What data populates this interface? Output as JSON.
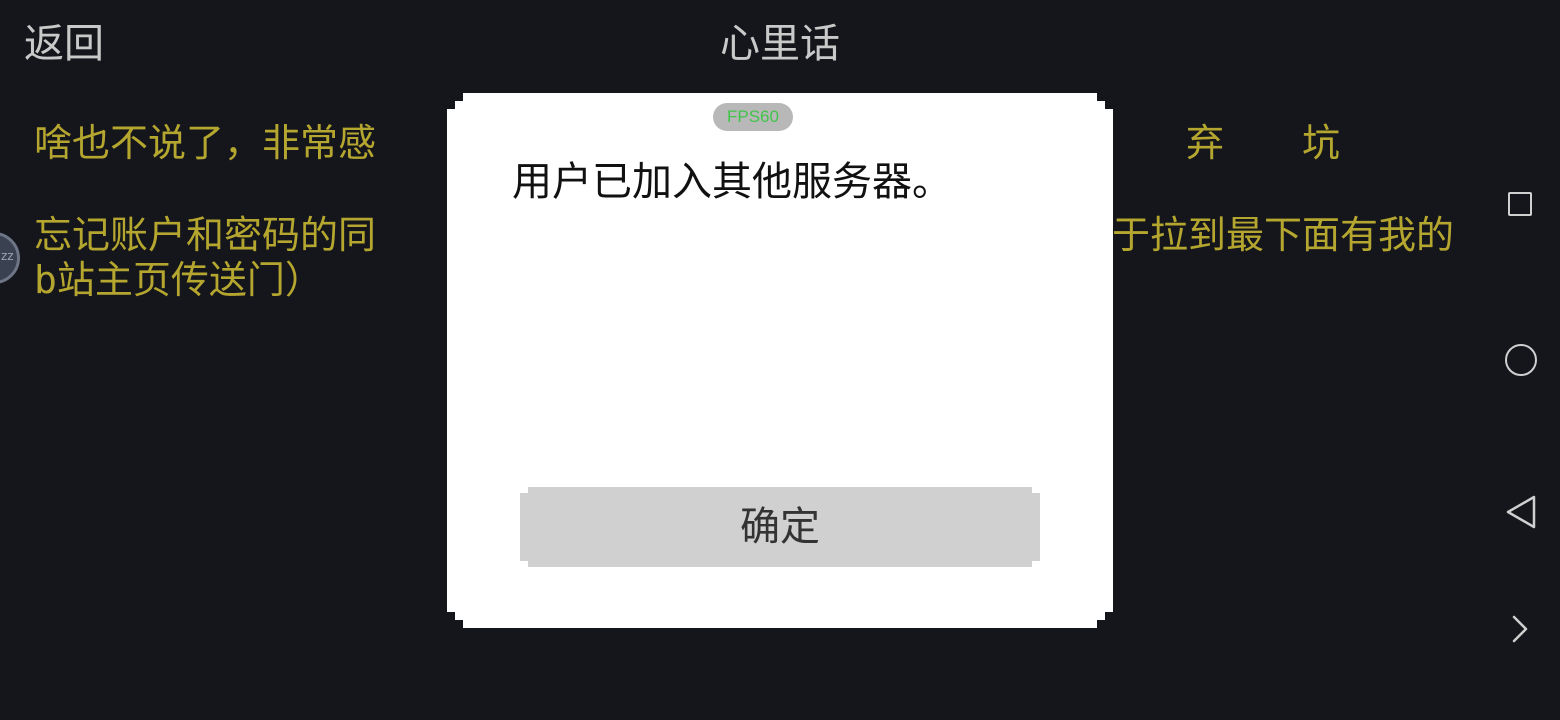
{
  "header": {
    "back_label": "返回",
    "title": "心里话"
  },
  "content": {
    "line1": "啥也不说了，非常感",
    "line1_right_a": "弃",
    "line1_right_b": "坑",
    "line2": "忘记账户和密码的同",
    "line2_right": "于拉到最下面有我的",
    "line3": "b站主页传送门）"
  },
  "floating_bubble": {
    "text": "zz"
  },
  "dialog": {
    "fps_badge": "FPS60",
    "message": "用户已加入其他服务器。",
    "confirm_label": "确定"
  },
  "colors": {
    "background": "#14161b",
    "content_text": "#b5a62f",
    "header_text": "#c9c9c9",
    "dialog_bg": "#ffffff",
    "button_bg": "#d0d0d0",
    "fps_text": "#41c44a"
  },
  "navbar": {
    "icons": [
      "recent-apps-icon",
      "home-icon",
      "back-icon",
      "expand-icon"
    ]
  }
}
